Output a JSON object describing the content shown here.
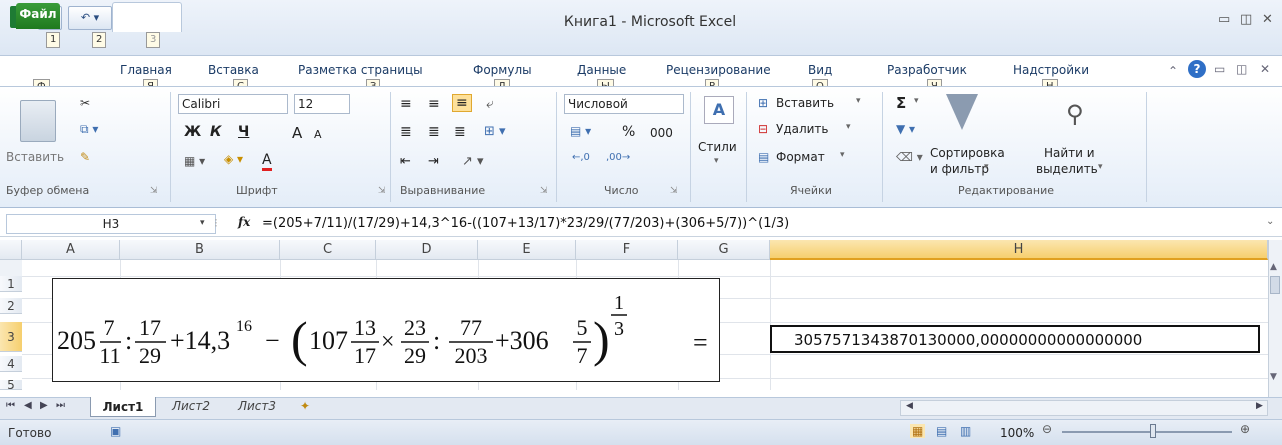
{
  "window": {
    "title": "Книга1 - Microsoft Excel"
  },
  "qat": {
    "keytips": [
      "1",
      "2",
      "3"
    ]
  },
  "tabs": [
    {
      "label": "Файл",
      "key": "Ф"
    },
    {
      "label": "Главная",
      "key": "Я"
    },
    {
      "label": "Вставка",
      "key": "С"
    },
    {
      "label": "Разметка страницы",
      "key": "З"
    },
    {
      "label": "Формулы",
      "key": "Л"
    },
    {
      "label": "Данные",
      "key": "Ы"
    },
    {
      "label": "Рецензирование",
      "key": "Р"
    },
    {
      "label": "Вид",
      "key": "О"
    },
    {
      "label": "Разработчик",
      "key": "Ч"
    },
    {
      "label": "Надстройки",
      "key": "Н"
    }
  ],
  "ribbon": {
    "clipboard": {
      "paste": "Вставить",
      "label": "Буфер обмена"
    },
    "font": {
      "name": "Calibri",
      "size": "12",
      "bold": "Ж",
      "italic": "К",
      "underline": "Ч",
      "grow": "A",
      "shrink": "A",
      "font_color": "A",
      "label": "Шрифт"
    },
    "alignment": {
      "label": "Выравнивание"
    },
    "number": {
      "format": "Числовой",
      "percent": "%",
      "thousands": "000",
      "label": "Число"
    },
    "styles": {
      "label": "Стили"
    },
    "cells": {
      "insert": "Вставить",
      "delete": "Удалить",
      "format": "Формат",
      "label": "Ячейки"
    },
    "editing": {
      "sum": "Σ",
      "sort_l1": "Сортировка",
      "sort_l2": "и фильтр",
      "find_l1": "Найти и",
      "find_l2": "выделить",
      "label": "Редактирование"
    }
  },
  "formula_bar": {
    "name_box": "H3",
    "fx": "fx",
    "formula": "=(205+7/11)/(17/29)+14,3^16-((107+13/17)*23/29/(77/203)+(306+5/7))^(1/3)"
  },
  "columns": [
    "A",
    "B",
    "C",
    "D",
    "E",
    "F",
    "G",
    "H"
  ],
  "rows": [
    "1",
    "2",
    "3",
    "4",
    "5"
  ],
  "equation": {
    "t1_whole": "205",
    "t1_num": "7",
    "t1_den": "11",
    "div1": ":",
    "t2_num": "17",
    "t2_den": "29",
    "plus1": "+14,3",
    "exp16": "16",
    "minus": "−",
    "lparen": "(",
    "t3_whole": "107",
    "t3_num": "13",
    "t3_den": "17",
    "times": "×",
    "t4_num": "23",
    "t4_den": "29",
    "div2": ":",
    "t5_num": "77",
    "t5_den": "203",
    "plus2": "+306",
    "t6_num": "5",
    "t6_den": "7",
    "rparen": ")",
    "exp_num": "1",
    "exp_den": "3",
    "equals": "="
  },
  "result": "305757134387013000​0,0000000000000000000",
  "result_display": "305757134387013000​0,00000000000000000",
  "sheets": [
    "Лист1",
    "Лист2",
    "Лист3"
  ],
  "status": {
    "ready": "Готово",
    "zoom": "100%"
  }
}
